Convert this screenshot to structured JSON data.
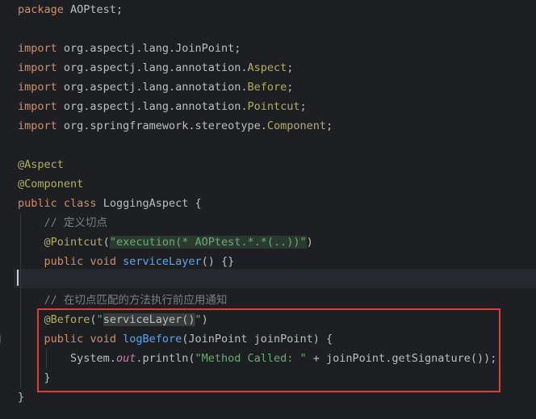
{
  "code": {
    "l1": {
      "kw": "package",
      "rest": " AOPtest;"
    },
    "l3": {
      "kw": "import",
      "rest": " org.aspectj.lang.JoinPoint;"
    },
    "l4": {
      "kw": "import",
      "rest": " org.aspectj.lang.annotation.",
      "cls": "Aspect",
      "end": ";"
    },
    "l5": {
      "kw": "import",
      "rest": " org.aspectj.lang.annotation.",
      "cls": "Before",
      "end": ";"
    },
    "l6": {
      "kw": "import",
      "rest": " org.aspectj.lang.annotation.",
      "cls": "Pointcut",
      "end": ";"
    },
    "l7": {
      "kw": "import",
      "rest": " org.springframework.stereotype.",
      "cls": "Component",
      "end": ";"
    },
    "l9": {
      "ann": "@Aspect"
    },
    "l10": {
      "ann": "@Component"
    },
    "l11": {
      "kw1": "public",
      "kw2": "class",
      "name": "LoggingAspect",
      "brace": " {"
    },
    "l12": {
      "cmt": "// 定义切点"
    },
    "l13": {
      "ann": "@Pointcut",
      "open": "(",
      "str": "\"execution(* AOPtest.*.*(..))\"",
      "close": ")"
    },
    "l14": {
      "kw1": "public",
      "kw2": "void",
      "fn": "serviceLayer",
      "rest": "() {}"
    },
    "l16": {
      "cmt": "// 在切点匹配的方法执行前应用通知"
    },
    "l17": {
      "ann": "@Before",
      "open": "(",
      "q1": "\"",
      "ref": "serviceLayer()",
      "q2": "\"",
      "close": ")"
    },
    "l18": {
      "kw1": "public",
      "kw2": "void",
      "fn": "logBefore",
      "rest": "(JoinPoint joinPoint) {"
    },
    "l19": {
      "pre": "System.",
      "static": "out",
      "mid": ".println(",
      "str": "\"Method Called: \"",
      "post": " + joinPoint.getSignature());"
    },
    "l20": {
      "brace": "}"
    },
    "l21": {
      "brace": "}"
    }
  }
}
